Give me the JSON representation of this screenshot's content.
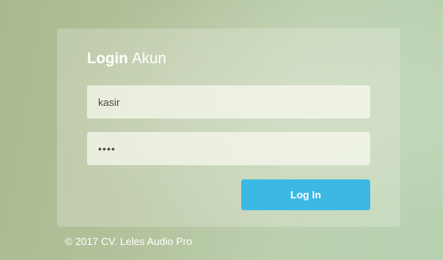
{
  "login": {
    "title_strong": "Login",
    "title_light": "Akun",
    "username_value": "kasir",
    "password_value": "kasi",
    "submit_label": "Log In"
  },
  "footer": {
    "copyright": "© 2017 CV. Leles Audio Pro"
  },
  "colors": {
    "accent_button": "#3bb8e4",
    "text_light": "#ffffff"
  }
}
